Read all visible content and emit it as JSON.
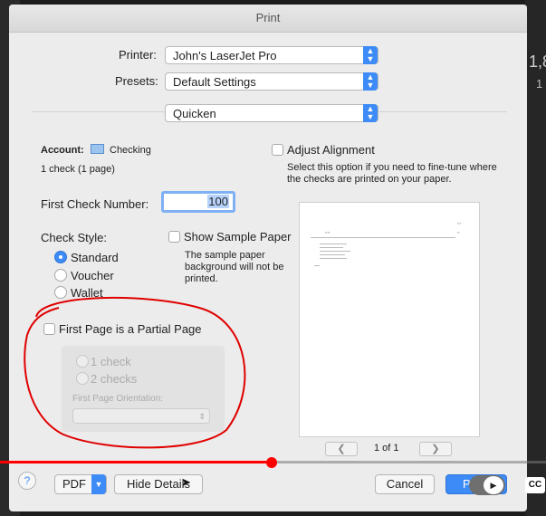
{
  "window": {
    "title": "Print"
  },
  "printer": {
    "label": "Printer:",
    "value": "John's LaserJet Pro"
  },
  "presets": {
    "label": "Presets:",
    "value": "Default Settings"
  },
  "app_pane": {
    "value": "Quicken"
  },
  "account": {
    "label": "Account:",
    "value": "Checking",
    "summary": "1 check (1 page)"
  },
  "adjust_alignment": {
    "label": "Adjust Alignment",
    "help": "Select this option if you need to fine-tune where the checks are printed on your paper.",
    "checked": false
  },
  "first_check": {
    "label": "First Check Number:",
    "value": "100"
  },
  "check_style": {
    "label": "Check Style:",
    "options": [
      "Standard",
      "Voucher",
      "Wallet"
    ],
    "selected": "Standard"
  },
  "sample_paper": {
    "label": "Show Sample Paper",
    "note": "The sample paper background will not be printed.",
    "checked": false
  },
  "partial_page": {
    "label": "First Page is a Partial Page",
    "checked": false,
    "options": [
      "1 check",
      "2 checks"
    ],
    "orientation_label": "First Page Orientation:",
    "orientation_value": ""
  },
  "preview": {
    "page_indicator": "1 of 1",
    "prev_icon": "chevron-left-icon",
    "next_icon": "chevron-right-icon"
  },
  "footer": {
    "help": "?",
    "pdf": "PDF",
    "hide_details": "Hide Details",
    "cancel": "Cancel",
    "print": "P"
  },
  "video_overlay": {
    "cc": "CC",
    "progress": 0.5
  },
  "background": {
    "right_text": "1,8",
    "right_text2": "1"
  },
  "colors": {
    "accent": "#3d8bf7",
    "annotation": "#e00000",
    "progress": "#ff0000"
  }
}
